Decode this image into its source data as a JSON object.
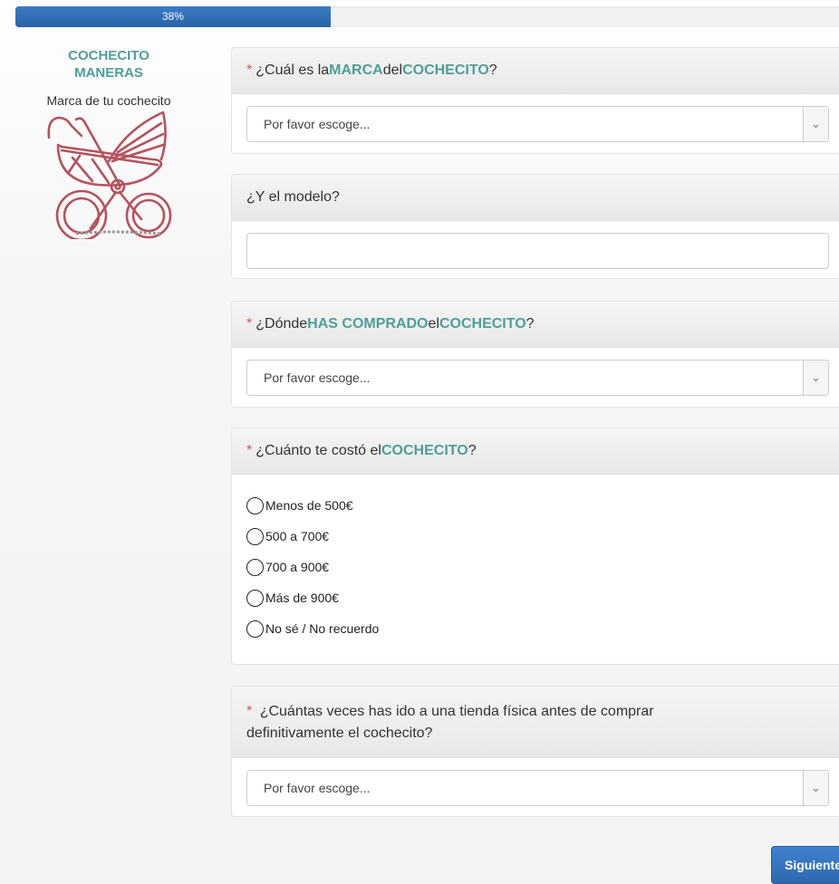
{
  "progress": {
    "label": "38%",
    "value": 0.38
  },
  "sidebar": {
    "brand_line1": "COCHECITO",
    "brand_line2": "MANERAS",
    "subtitle": "Marca de tu cochecito"
  },
  "q1": {
    "required": "*",
    "t1": "¿Cuál es la ",
    "h1": "MARCA",
    "t2": " del ",
    "h2": "COCHECITO",
    "t3": "?",
    "select_value": "Por favor escoge..."
  },
  "q2": {
    "title": "¿Y el modelo?",
    "input_value": ""
  },
  "q3": {
    "required": "*",
    "t1": "¿Dónde ",
    "h1": "HAS COMPRADO",
    "t2": " el ",
    "h2": "COCHECITO",
    "t3": "?",
    "select_value": "Por favor escoge..."
  },
  "q4": {
    "required": "*",
    "t1": "¿Cuánto te costó el ",
    "h1": "COCHECITO",
    "t2": "?",
    "options": [
      "Menos de 500€",
      "500 a 700€",
      "700 a 900€",
      "Más de 900€",
      "No sé / No recuerdo"
    ]
  },
  "q5": {
    "required": "*",
    "line1": "¿Cuántas veces has ido a una tienda física antes de comprar",
    "line2": "definitivamente el cochecito?",
    "select_value": "Por favor escoge..."
  },
  "buttons": {
    "next_label": "Siguiente"
  },
  "colors": {
    "accent": "#4e9e98",
    "required": "#d9534f",
    "progress": "#2f6fb8",
    "illustration": "#b5525d"
  }
}
